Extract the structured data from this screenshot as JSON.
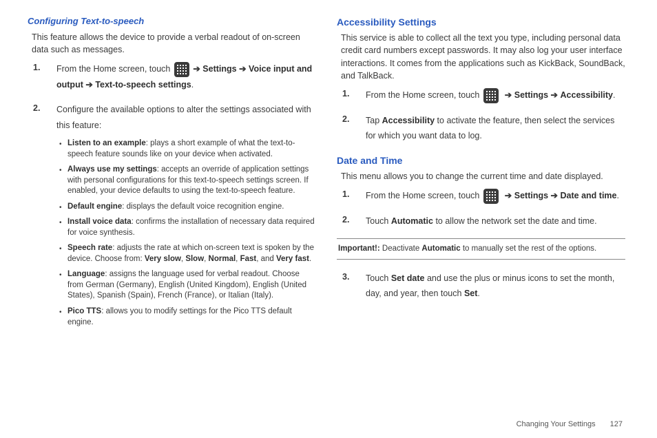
{
  "left": {
    "title": "Configuring Text-to-speech",
    "intro": "This feature allows the device to provide a verbal readout of on-screen data such as messages.",
    "step1_a": "From the Home screen, touch ",
    "step1_b": " Settings ",
    "step1_c": " Voice input and output ",
    "step1_d": " Text-to-speech settings",
    "step2": "Configure the available options to alter the settings associated with this feature:",
    "bullets": {
      "b1_name": "Listen to an example",
      "b1_text": ": plays a short example of what the text-to-speech feature sounds like on your device when activated.",
      "b2_name": "Always use my settings",
      "b2_text": ": accepts an override of application settings with personal configurations for this text-to-speech settings screen. If enabled, your device defaults to using the text-to-speech feature.",
      "b3_name": "Default engine",
      "b3_text": ": displays the default voice recognition engine.",
      "b4_name": "Install voice data",
      "b4_text": ": confirms the installation of necessary data required for voice synthesis.",
      "b5_name": "Speech rate",
      "b5_text_a": ": adjusts the rate at which on-screen text is spoken by the device. Choose from: ",
      "b5_vs": "Very slow",
      "b5_s": "Slow",
      "b5_n": "Normal",
      "b5_f": "Fast",
      "b5_and": ", and ",
      "b5_vf": "Very fast",
      "b6_name": "Language",
      "b6_text": ": assigns the language used for verbal readout. Choose from German (Germany), English (United Kingdom), English (United States), Spanish (Spain), French (France), or Italian (Italy).",
      "b7_name": "Pico TTS",
      "b7_text": ": allows you to modify settings for the Pico TTS default engine."
    }
  },
  "right": {
    "acc_title": "Accessibility Settings",
    "acc_intro": "This service is able to collect all the text you type, including personal data credit card numbers except passwords. It may also log your user interface interactions. It comes from the applications such as KickBack, SoundBack, and TalkBack.",
    "acc_s1_a": "From the Home screen, touch ",
    "acc_s1_b": " Settings ",
    "acc_s1_c": "Accessibility",
    "acc_s2_a": "Tap ",
    "acc_s2_b": "Accessibility",
    "acc_s2_c": " to activate the feature, then select the services for which you want data to log.",
    "dt_title": "Date and Time",
    "dt_intro": "This menu allows you to change the current time and date displayed.",
    "dt_s1_a": "From the Home screen, touch ",
    "dt_s1_b": " Settings ",
    "dt_s1_c": "Date and time",
    "dt_s2_a": "Touch ",
    "dt_s2_b": "Automatic",
    "dt_s2_c": " to allow the network set the date and time.",
    "note_a": "Important!: ",
    "note_b": "Deactivate ",
    "note_c": "Automatic",
    "note_d": " to manually set the rest of the options.",
    "dt_s3_a": "Touch ",
    "dt_s3_b": "Set date",
    "dt_s3_c": " and use the plus or minus icons to set the month, day, and year, then touch ",
    "dt_s3_d": "Set"
  },
  "nums": {
    "n1": "1.",
    "n2": "2.",
    "n3": "3."
  },
  "arrow": "➔",
  "comma": ", ",
  "period": ".",
  "footer": {
    "section": "Changing Your Settings",
    "page": "127"
  }
}
